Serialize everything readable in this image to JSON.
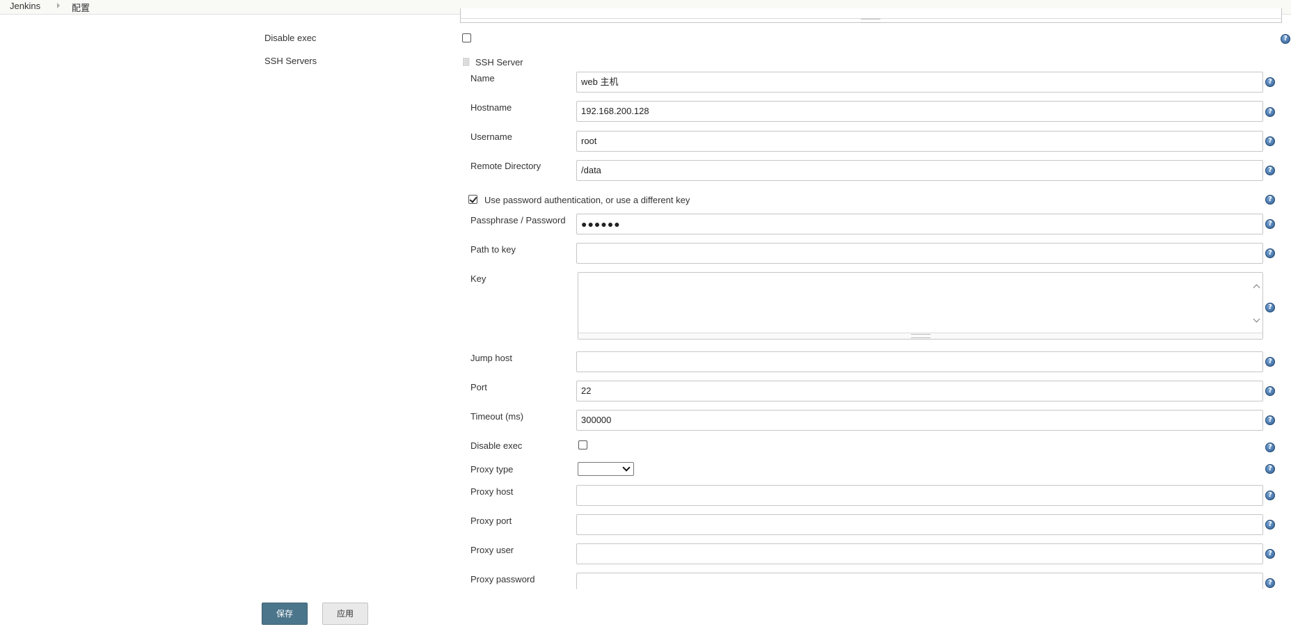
{
  "breadcrumb": {
    "root": "Jenkins",
    "current": "配置"
  },
  "outer": {
    "disable_exec_label": "Disable exec",
    "ssh_servers_label": "SSH Servers"
  },
  "ssh_server": {
    "section_title": "SSH Server",
    "name_label": "Name",
    "name_value": "web 主机",
    "hostname_label": "Hostname",
    "hostname_value": "192.168.200.128",
    "username_label": "Username",
    "username_value": "root",
    "remote_directory_label": "Remote Directory",
    "remote_directory_value": "/data",
    "use_password_label": "Use password authentication, or use a different key",
    "use_password_checked": true,
    "passphrase_label": "Passphrase / Password",
    "passphrase_value": "●●●●●●",
    "path_to_key_label": "Path to key",
    "path_to_key_value": "",
    "key_label": "Key",
    "key_value": "",
    "jump_host_label": "Jump host",
    "jump_host_value": "",
    "port_label": "Port",
    "port_value": "22",
    "timeout_label": "Timeout (ms)",
    "timeout_value": "300000",
    "disable_exec_label": "Disable exec",
    "disable_exec_checked": false,
    "proxy_type_label": "Proxy type",
    "proxy_type_value": "",
    "proxy_host_label": "Proxy host",
    "proxy_host_value": "",
    "proxy_port_label": "Proxy port",
    "proxy_port_value": "",
    "proxy_user_label": "Proxy user",
    "proxy_user_value": "",
    "proxy_password_label": "Proxy password",
    "proxy_password_value": ""
  },
  "buttons": {
    "save": "保存",
    "apply": "应用"
  },
  "icons": {
    "help": "help-icon",
    "help_glyph": "?"
  },
  "colors": {
    "save_button_bg": "#4b758b",
    "apply_button_bg": "#e9e9e9",
    "help_icon": "#2f5e93"
  }
}
